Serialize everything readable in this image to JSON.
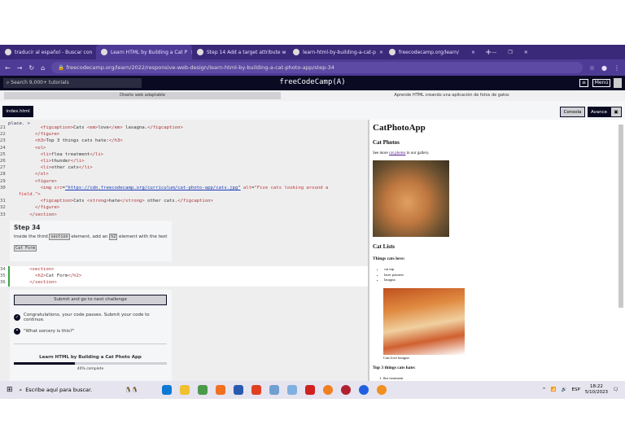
{
  "browser": {
    "tabs": [
      {
        "title": "traducir al español - Buscar con",
        "active": false
      },
      {
        "title": "Learn HTML by Building a Cat P",
        "active": true
      },
      {
        "title": "Step 14 Add a target attribute w",
        "active": false
      },
      {
        "title": "learn-html-by-building-a-cat-p",
        "active": false
      },
      {
        "title": "freecodecamp.org/learn/",
        "active": false
      }
    ],
    "url": "freecodecamp.org/learn/2022/responsive-web-design/learn-html-by-building-a-cat-photo-app/step-34"
  },
  "nav": {
    "search_placeholder": "Search 9,000+ tutorials",
    "logo": "freeCodeCamp(A)",
    "menu": "Menú"
  },
  "breadcrumb": {
    "first": "Diseño web adaptable",
    "second": "Aprende HTML creando una aplicación de fotos de gatos"
  },
  "toolbar": {
    "file_tab": "index.html",
    "console": "Consola",
    "advance": "Avance"
  },
  "editor": {
    "top_fragment": "place. >",
    "lines": [
      {
        "n": "21",
        "html": "          <span class=tag>&lt;figcaption&gt;</span>Cats <span class=tag>&lt;em&gt;</span>love<span class=tag>&lt;/em&gt;</span> lasagna.<span class=tag>&lt;/figcaption&gt;</span>"
      },
      {
        "n": "22",
        "html": "        <span class=tag>&lt;/figure&gt;</span>"
      },
      {
        "n": "23",
        "html": "        <span class=tag>&lt;h3&gt;</span>Top 3 things cats hate:<span class=tag>&lt;/h3&gt;</span>"
      },
      {
        "n": "24",
        "html": "        <span class=tag>&lt;ol&gt;</span>"
      },
      {
        "n": "25",
        "html": "          <span class=tag>&lt;li&gt;</span>flea treatment<span class=tag>&lt;/li&gt;</span>"
      },
      {
        "n": "26",
        "html": "          <span class=tag>&lt;li&gt;</span>thunder<span class=tag>&lt;/li&gt;</span>"
      },
      {
        "n": "27",
        "html": "          <span class=tag>&lt;li&gt;</span>other cats<span class=tag>&lt;/li&gt;</span>"
      },
      {
        "n": "28",
        "html": "        <span class=tag>&lt;/ol&gt;</span>"
      },
      {
        "n": "29",
        "html": "        <span class=tag>&lt;figure&gt;</span>"
      },
      {
        "n": "30",
        "html": "          <span class=tag>&lt;img</span> <span class=attr>src</span>=<span class=str>\"https://cdn.freecodecamp.org/curriculum/cat-photo-app/cats.jpg\"</span> <span class=attr>alt</span>=<span class=attr>\"Five cats looking around a</span>"
      },
      {
        "n": "",
        "html": "  <span class=attr>field.\"</span><span class=tag>&gt;</span>"
      },
      {
        "n": "31",
        "html": "          <span class=tag>&lt;figcaption&gt;</span>Cats <span class=tag>&lt;strong&gt;</span>hate<span class=tag>&lt;/strong&gt;</span> other cats.<span class=tag>&lt;/figcaption&gt;</span>"
      },
      {
        "n": "32",
        "html": "        <span class=tag>&lt;/figure&gt;</span>"
      },
      {
        "n": "33",
        "html": "      <span class=tag>&lt;/section&gt;</span>"
      }
    ],
    "edit_lines": [
      {
        "n": "34",
        "html": "      <span class=tag>&lt;section&gt;</span>"
      },
      {
        "n": "35",
        "html": "        <span class=tag>&lt;h2&gt;</span>Cat Form<span class=tag>&lt;/h2&gt;</span>"
      },
      {
        "n": "36",
        "html": "      <span class=tag>&lt;/section&gt;</span>"
      }
    ]
  },
  "step": {
    "title": "Step 34",
    "text_before": "Inside the third",
    "code1": "section",
    "text_mid": "element, add an",
    "code2": "h2",
    "text_after": "element with the text",
    "code3": "Cat Form"
  },
  "panel": {
    "submit": "Submit and go to next challenge",
    "pass_msg": "Congratulations, your code passes. Submit your code to continue.",
    "quote": "\"What sorcery is this?\"",
    "course_title": "Learn HTML by Building a Cat Photo App",
    "progress_percent": 40,
    "progress_label": "40% complete"
  },
  "preview": {
    "h1": "CatPhotoApp",
    "h2_photos": "Cat Photos",
    "p_before": "See more ",
    "p_link": "cat photos",
    "p_after": " in our gallery.",
    "h2_lists": "Cat Lists",
    "h3_love": "Things cats love:",
    "love": [
      "cat nip",
      "laser pointers",
      "lasagna."
    ],
    "fig_caption": "Cats love lasagna.",
    "h3_hate": "Top 3 things cats hate:",
    "hate_first": "flea treatment"
  },
  "taskbar": {
    "search": "Escribe aquí para buscar.",
    "lang": "ESP",
    "time": "18:22",
    "date": "5/10/2023"
  },
  "colors": {
    "tabbar": "#3a2878",
    "fcc_nav": "#0a0a23",
    "accent_dark": "#0a0a23"
  }
}
